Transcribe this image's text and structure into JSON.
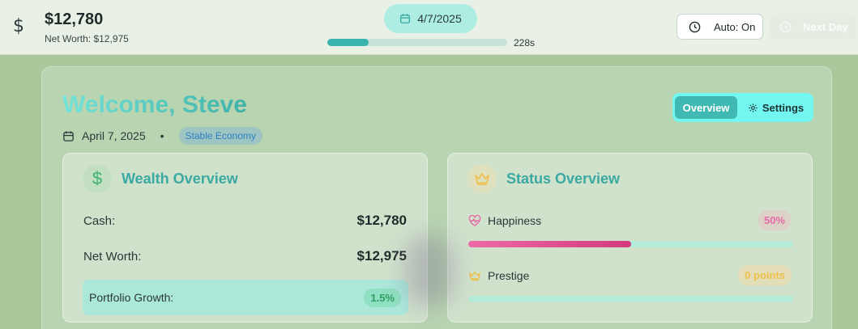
{
  "header": {
    "cash": "$12,780",
    "net_worth": "Net Worth: $12,975",
    "date": "4/7/2025",
    "timer": "228s",
    "timer_progress_percent": 23,
    "auto_label": "Auto: On",
    "next_label": "Next Day"
  },
  "main": {
    "welcome": "Welcome, Steve",
    "date_long": "April 7, 2025",
    "separator": "•",
    "economy_badge": "Stable Economy",
    "tabs": [
      {
        "label": "Overview",
        "active": true
      },
      {
        "label": "Settings",
        "active": false
      }
    ]
  },
  "wealth": {
    "title": "Wealth Overview",
    "cash_label": "Cash:",
    "cash_value": "$12,780",
    "networth_label": "Net Worth:",
    "networth_value": "$12,975",
    "growth_label": "Portfolio Growth:",
    "growth_value": "1.5%"
  },
  "status": {
    "title": "Status Overview",
    "happiness_label": "Happiness",
    "happiness_value": "50%",
    "happiness_percent": 50,
    "prestige_label": "Prestige",
    "prestige_value": "0 points",
    "prestige_percent": 0
  },
  "colors": {
    "accent_teal": "#3fb9b2",
    "happiness_pink": "#e86aa6",
    "prestige_gold": "#efc04a",
    "growth_green": "#2f9e62"
  }
}
